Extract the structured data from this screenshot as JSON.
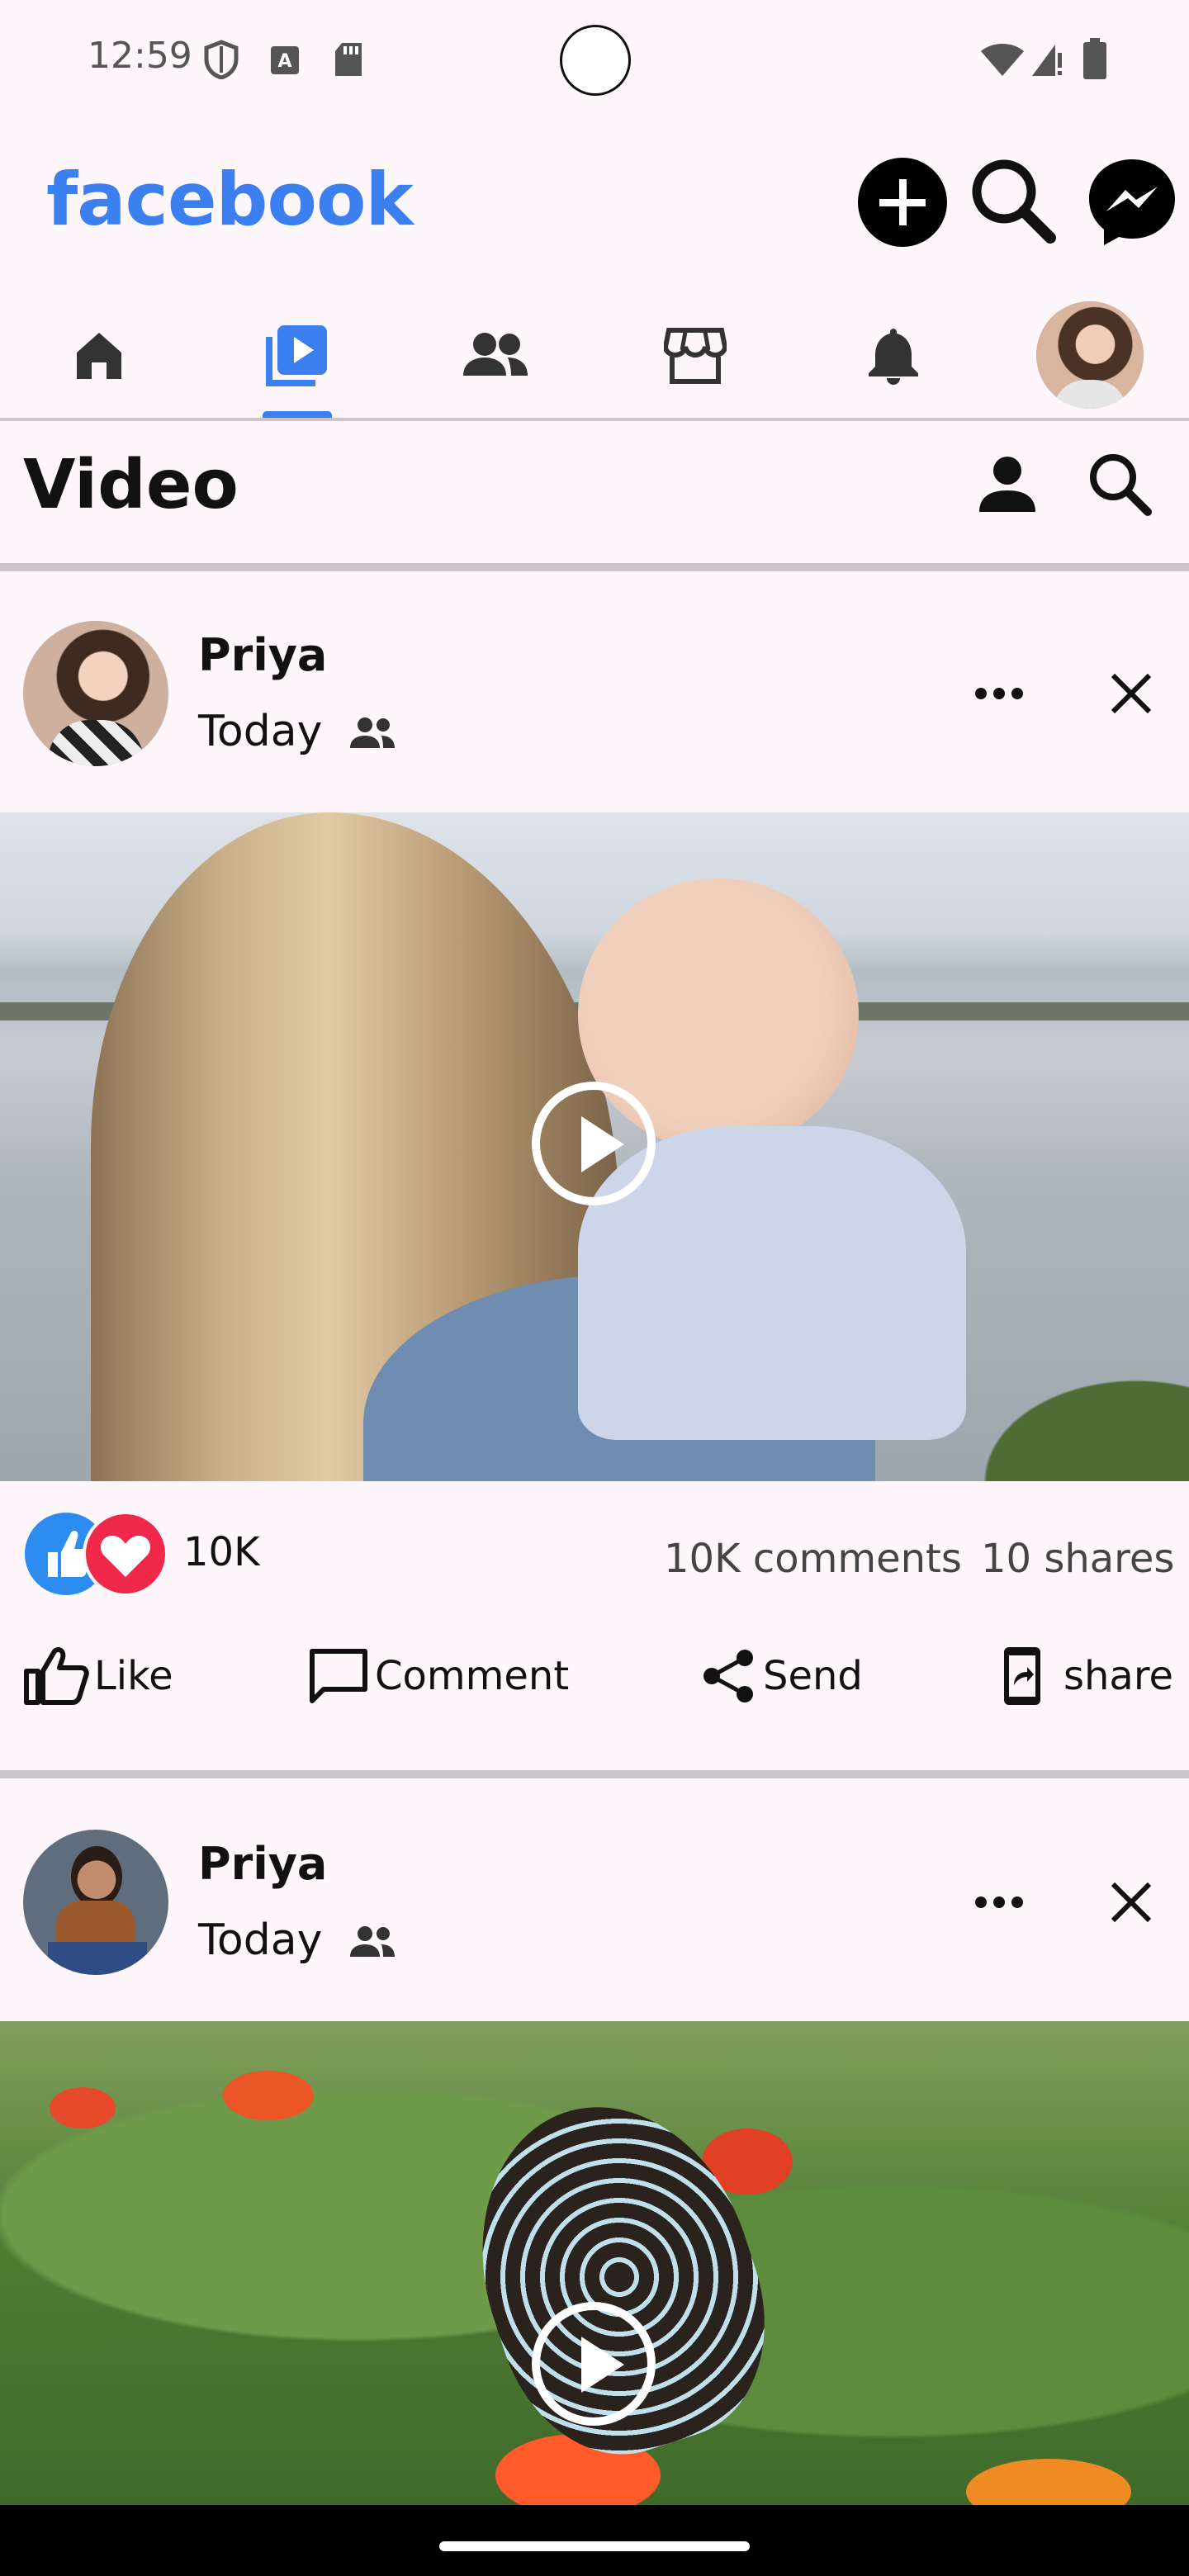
{
  "status_bar": {
    "time": "12:59"
  },
  "app": {
    "logo": "facebook"
  },
  "section": {
    "title": "Video"
  },
  "posts": [
    {
      "author": "Priya",
      "time": "Today",
      "reactions_count": "10K",
      "comments": "10K comments",
      "shares": "10 shares"
    },
    {
      "author": "Priya",
      "time": "Today"
    }
  ],
  "actions": {
    "like": "Like",
    "comment": "Comment",
    "send": "Send",
    "share": "share"
  },
  "colors": {
    "brand": "#3b7ff0",
    "background": "#fdf6fb",
    "like_blue": "#2d8cf0",
    "love_red": "#f0284a"
  }
}
